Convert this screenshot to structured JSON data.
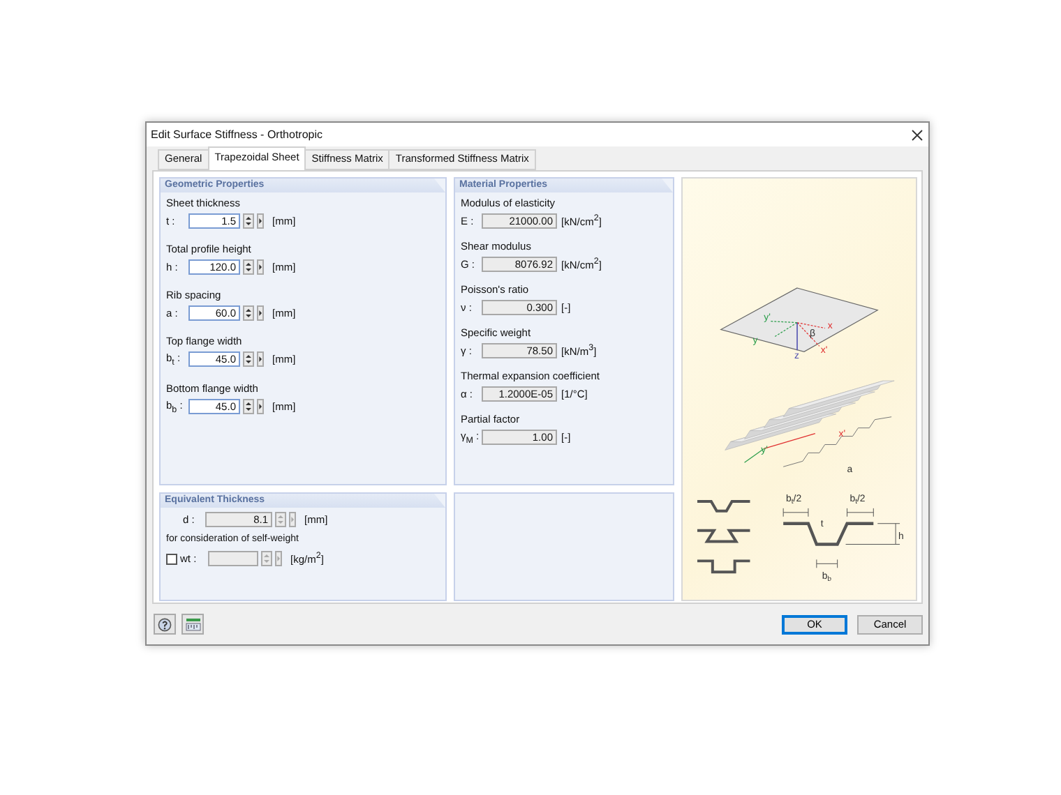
{
  "window": {
    "title": "Edit Surface Stiffness - Orthotropic"
  },
  "tabs": [
    {
      "label": "General",
      "selected": false
    },
    {
      "label": "Trapezoidal Sheet",
      "selected": true
    },
    {
      "label": "Stiffness Matrix",
      "selected": false
    },
    {
      "label": "Transformed Stiffness Matrix",
      "selected": false
    }
  ],
  "geometric": {
    "title": "Geometric Properties",
    "fields": [
      {
        "label": "Sheet thickness",
        "symbol": "t :",
        "value": "1.5",
        "unit": "[mm]"
      },
      {
        "label": "Total profile height",
        "symbol": "h :",
        "value": "120.0",
        "unit": "[mm]"
      },
      {
        "label": "Rib spacing",
        "symbol": "a :",
        "value": "60.0",
        "unit": "[mm]"
      },
      {
        "label": "Top flange width",
        "symbol": "b$_{t}$ :",
        "value": "45.0",
        "unit": "[mm]"
      },
      {
        "label": "Bottom flange width",
        "symbol": "b$_{b}$ :",
        "value": "45.0",
        "unit": "[mm]"
      }
    ]
  },
  "material": {
    "title": "Material Properties",
    "fields": [
      {
        "label": "Modulus of elasticity",
        "symbol": "E :",
        "value": "21000.00",
        "unit": "[kN/cm$^{2}$]"
      },
      {
        "label": "Shear modulus",
        "symbol": "G :",
        "value": "8076.92",
        "unit": "[kN/cm$^{2}$]"
      },
      {
        "label": "Poisson's ratio",
        "symbol": "ν :",
        "value": "0.300",
        "unit": "[-]"
      },
      {
        "label": "Specific weight",
        "symbol": "γ :",
        "value": "78.50",
        "unit": "[kN/m$^{3}$]"
      },
      {
        "label": "Thermal expansion coefficient",
        "symbol": "α :",
        "value": "1.2000E-05",
        "unit": "[1/°C]"
      },
      {
        "label": "Partial factor",
        "symbol": "γ$_{M}$ :",
        "value": "1.00",
        "unit": "[-]"
      }
    ]
  },
  "equivalent": {
    "title": "Equivalent Thickness",
    "thickness": {
      "symbol": "d :",
      "value": "8.1",
      "unit": "[mm]"
    },
    "note": "for consideration of self-weight",
    "weight": {
      "checked": false,
      "symbol": "wt :",
      "unit": "[kg/m$^{2}$]"
    }
  },
  "figure": {
    "labels": [
      {
        "text": "y'"
      },
      {
        "text": "y"
      },
      {
        "text": "x"
      },
      {
        "text": "x'"
      },
      {
        "text": "z"
      },
      {
        "text": "β"
      },
      {
        "text": "y'"
      },
      {
        "text": "x'"
      },
      {
        "text": "a"
      },
      {
        "text": "b",
        "sub": "t",
        "suffix": "/2"
      },
      {
        "text": "b",
        "sub": "t",
        "suffix": "/2"
      },
      {
        "text": "t"
      },
      {
        "text": "h"
      },
      {
        "text": "b",
        "sub": "b"
      }
    ]
  },
  "buttons": [
    {
      "label": "OK",
      "default": true
    },
    {
      "label": "Cancel",
      "default": false
    }
  ]
}
